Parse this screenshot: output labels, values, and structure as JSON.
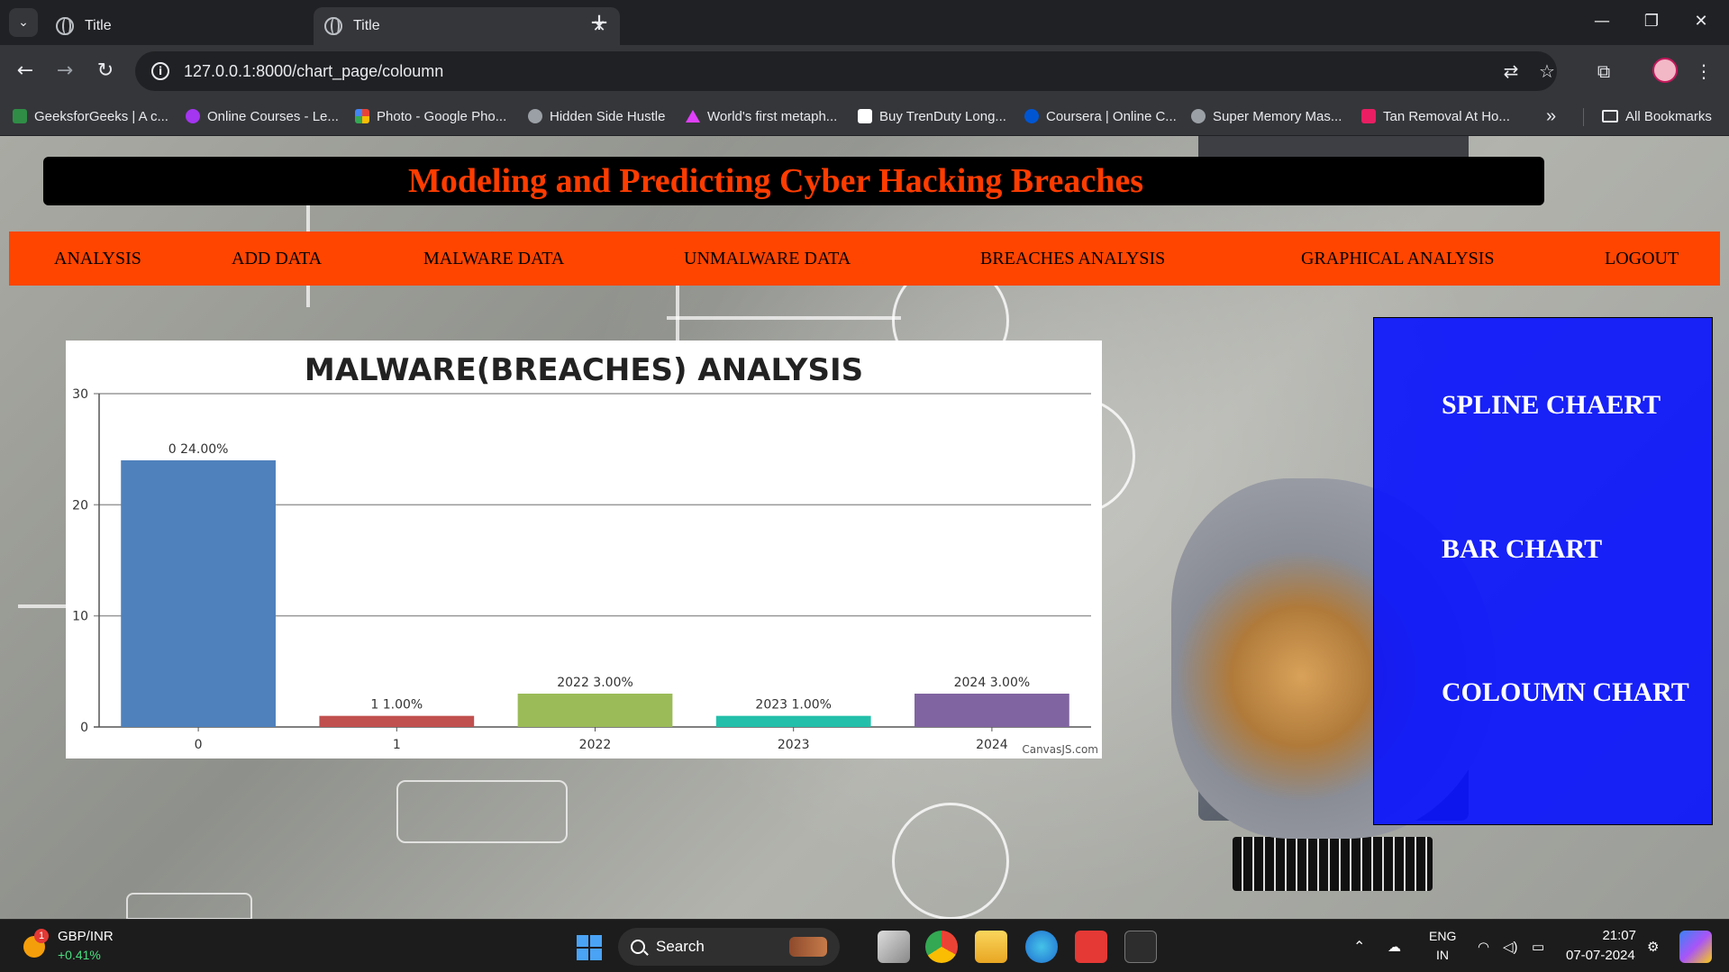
{
  "browser": {
    "tabs": [
      {
        "title": "Title",
        "active": false
      },
      {
        "title": "Title",
        "active": true
      }
    ],
    "url": "127.0.0.1:8000/chart_page/coloumn",
    "bookmarks": [
      {
        "label": "GeeksforGeeks | A c...",
        "color": "#2f8d46"
      },
      {
        "label": "Online Courses - Le...",
        "color": "#a435f0"
      },
      {
        "label": "Photo - Google Pho...",
        "color": "#fbbc04"
      },
      {
        "label": "Hidden Side Hustle",
        "color": "#9aa0a6"
      },
      {
        "label": "World's first metaph...",
        "color": "#e040fb"
      },
      {
        "label": "Buy TrenDuty Long...",
        "color": "#ffffff"
      },
      {
        "label": "Coursera | Online C...",
        "color": "#0056d2"
      },
      {
        "label": "Super Memory Mas...",
        "color": "#9aa0a6"
      },
      {
        "label": "Tan Removal At Ho...",
        "color": "#e91e63"
      }
    ],
    "more_bookmarks": "»",
    "all_bookmarks": "All Bookmarks"
  },
  "page": {
    "title": "Modeling and Predicting Cyber Hacking Breaches",
    "nav": [
      "ANALYSIS",
      "ADD DATA",
      "MALWARE DATA",
      "UNMALWARE DATA",
      "BREACHES ANALYSIS",
      "GRAPHICAL ANALYSIS",
      "LOGOUT"
    ],
    "side_menu": [
      "SPLINE CHAERT",
      "BAR CHART",
      "COLOUMN CHART"
    ],
    "colors": {
      "header_text": "#ff3c00",
      "nav_bg": "#ff4500",
      "side_menu_bg": "#0812ff"
    }
  },
  "chart_data": {
    "type": "bar",
    "title": "MALWARE(BREACHES) ANALYSIS",
    "categories": [
      "0",
      "1",
      "2022",
      "2023",
      "2024"
    ],
    "values": [
      24,
      1,
      3,
      1,
      3
    ],
    "data_labels": [
      "0 24.00%",
      "1 1.00%",
      "2022 3.00%",
      "2023 1.00%",
      "2024 3.00%"
    ],
    "colors": [
      "#4f81bc",
      "#c0504e",
      "#9bbb58",
      "#23bfaa",
      "#8064a1"
    ],
    "ylim": [
      0,
      30
    ],
    "yticks": [
      0,
      10,
      20,
      30
    ],
    "grid": true,
    "credit": "CanvasJS.com"
  },
  "taskbar": {
    "ticker_name": "GBP/INR",
    "ticker_change": "+0.41%",
    "widget_badge": "1",
    "search_label": "Search",
    "language": "ENG",
    "region": "IN",
    "time": "21:07",
    "date": "07-07-2024"
  }
}
